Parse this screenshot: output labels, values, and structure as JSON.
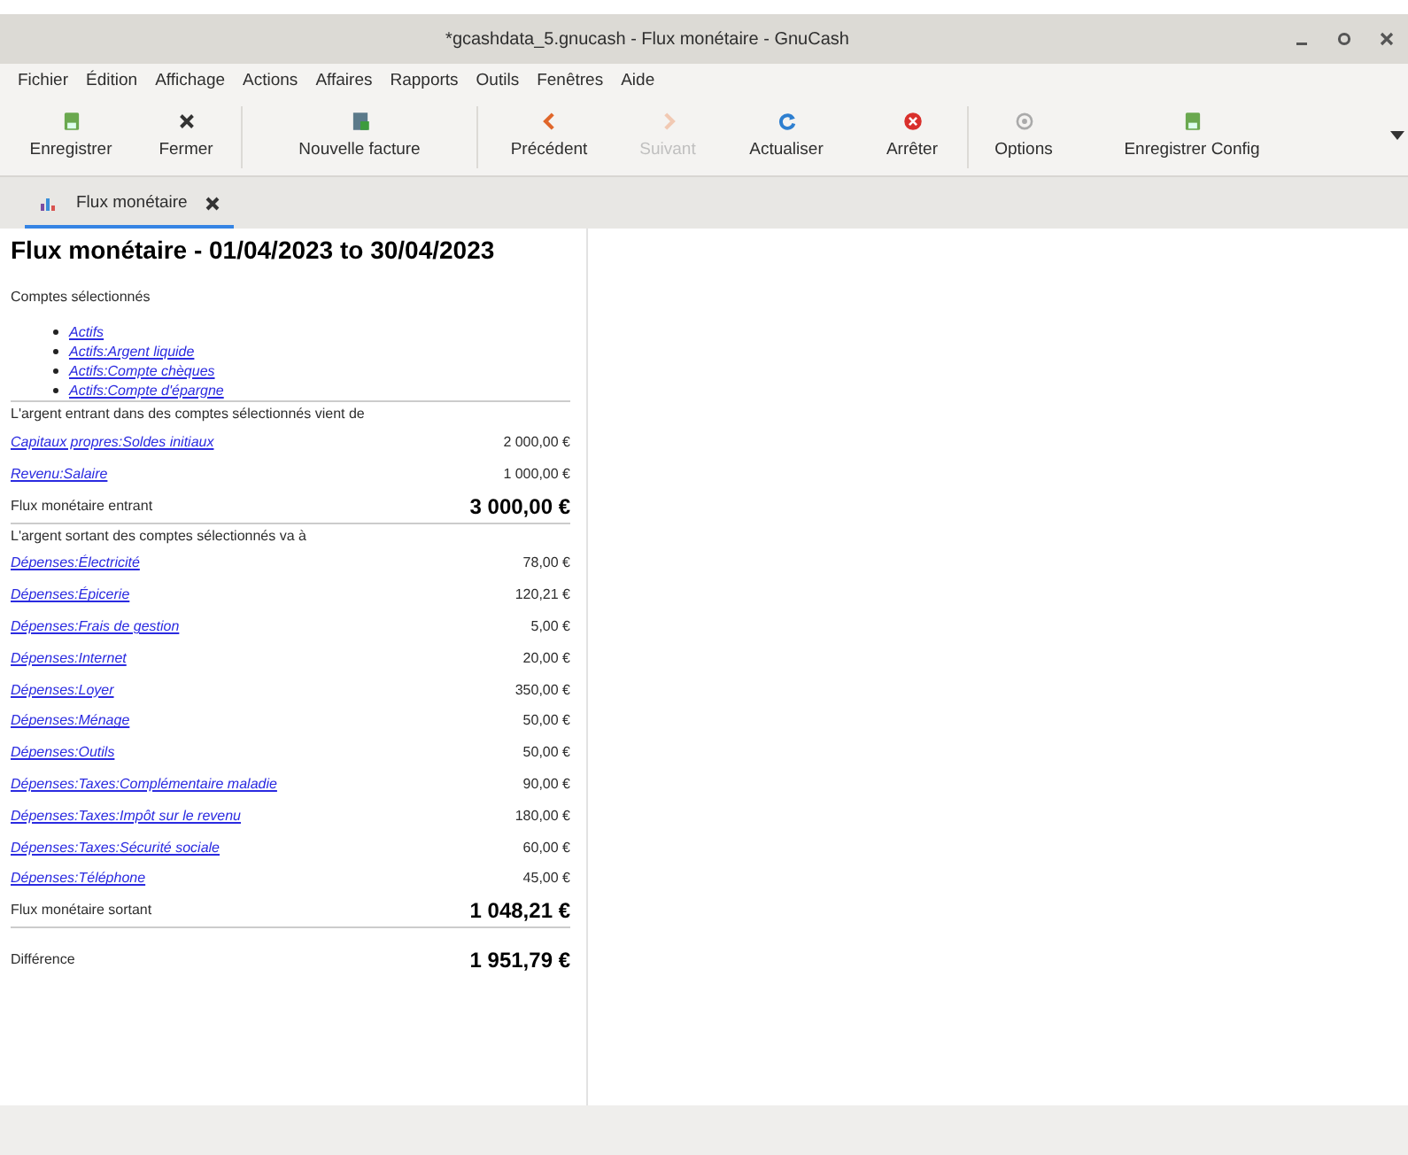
{
  "window": {
    "title": "*gcashdata_5.gnucash - Flux monétaire - GnuCash"
  },
  "menu": [
    "Fichier",
    "Édition",
    "Affichage",
    "Actions",
    "Affaires",
    "Rapports",
    "Outils",
    "Fenêtres",
    "Aide"
  ],
  "toolbar": [
    [
      {
        "label": "Enregistrer",
        "kind": "save",
        "disabled": false
      },
      {
        "label": "Fermer",
        "kind": "close",
        "disabled": false
      }
    ],
    [
      {
        "label": "Nouvelle facture",
        "kind": "invoice",
        "disabled": false
      }
    ],
    [
      {
        "label": "Précédent",
        "kind": "back",
        "disabled": false
      },
      {
        "label": "Suivant",
        "kind": "forward",
        "disabled": true
      },
      {
        "label": "Actualiser",
        "kind": "refresh",
        "disabled": false
      },
      {
        "label": "Arrêter",
        "kind": "stop",
        "disabled": false
      }
    ],
    [
      {
        "label": "Options",
        "kind": "options",
        "disabled": false
      },
      {
        "label": "Enregistrer Config",
        "kind": "save",
        "disabled": false
      }
    ]
  ],
  "tabs": [
    {
      "label": "Flux monétaire",
      "selected": true
    }
  ],
  "report": {
    "title": "Flux monétaire - 01/04/2023 to 30/04/2023",
    "accounts_heading": "Comptes sélectionnés",
    "accounts": [
      "Actifs",
      "Actifs:Argent liquide",
      "Actifs:Compte chèques",
      "Actifs:Compte d'épargne"
    ],
    "incoming": {
      "heading": "L'argent entrant dans des comptes sélectionnés vient de",
      "rows": [
        {
          "account": "Capitaux propres:Soldes initiaux",
          "amount": "2 000,00 €"
        },
        {
          "account": "Revenu:Salaire",
          "amount": "1 000,00 €"
        }
      ],
      "total_label": "Flux monétaire entrant",
      "total": "3 000,00 €"
    },
    "outgoing": {
      "heading": "L'argent sortant des comptes sélectionnés va à",
      "rows": [
        {
          "account": "Dépenses:Électricité",
          "amount": "78,00 €"
        },
        {
          "account": "Dépenses:Épicerie",
          "amount": "120,21 €"
        },
        {
          "account": "Dépenses:Frais de gestion",
          "amount": "5,00 €"
        },
        {
          "account": "Dépenses:Internet",
          "amount": "20,00 €"
        },
        {
          "account": "Dépenses:Loyer",
          "amount": "350,00 €"
        },
        {
          "account": "Dépenses:Ménage",
          "amount": "50,00 €"
        },
        {
          "account": "Dépenses:Outils",
          "amount": "50,00 €"
        },
        {
          "account": "Dépenses:Taxes:Complémentaire maladie",
          "amount": "90,00 €"
        },
        {
          "account": "Dépenses:Taxes:Impôt sur le revenu",
          "amount": "180,00 €"
        },
        {
          "account": "Dépenses:Taxes:Sécurité sociale",
          "amount": "60,00 €"
        },
        {
          "account": "Dépenses:Téléphone",
          "amount": "45,00 €"
        }
      ],
      "total_label": "Flux monétaire sortant",
      "total": "1 048,21 €"
    },
    "difference_label": "Différence",
    "difference": "1 951,79 €"
  }
}
